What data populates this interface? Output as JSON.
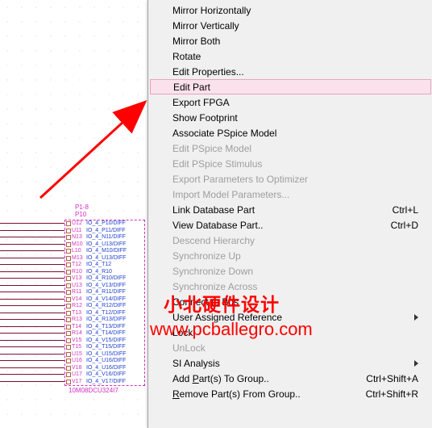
{
  "part": {
    "header_top": "P10",
    "header_group": "P1-8",
    "footer": "10M08DCU324I7",
    "pins": [
      {
        "num": "U12",
        "name": "IO_4_P10/DIFF"
      },
      {
        "num": "U11",
        "name": "IO_4_P11/DIFF"
      },
      {
        "num": "N13",
        "name": "IO_4_N11/DIFF"
      },
      {
        "num": "M10",
        "name": "IO_4_U13/DIFF"
      },
      {
        "num": "L10",
        "name": "IO_4_M10/DIFF"
      },
      {
        "num": "M13",
        "name": "IO_4_U13/DIFF"
      },
      {
        "num": "T12",
        "name": "IO_4_T12"
      },
      {
        "num": "R10",
        "name": "IO_4_R10"
      },
      {
        "num": "V13",
        "name": "IO_4_R10/DIFF"
      },
      {
        "num": "U13",
        "name": "IO_4_V13/DIFF"
      },
      {
        "num": "R11",
        "name": "IO_4_R11/DIFF"
      },
      {
        "num": "V14",
        "name": "IO_4_V14/DIFF"
      },
      {
        "num": "R12",
        "name": "IO_4_R12/DIFF"
      },
      {
        "num": "T13",
        "name": "IO_4_T12/DIFF"
      },
      {
        "num": "R13",
        "name": "IO_4_R13/DIFF"
      },
      {
        "num": "T14",
        "name": "IO_4_T13/DIFF"
      },
      {
        "num": "R14",
        "name": "IO_4_T14/DIFF"
      },
      {
        "num": "V15",
        "name": "IO_4_V15/DIFF"
      },
      {
        "num": "T15",
        "name": "IO_4_T15/DIFF"
      },
      {
        "num": "U15",
        "name": "IO_4_U15/DIFF"
      },
      {
        "num": "U16",
        "name": "IO_4_U16/DIFF"
      },
      {
        "num": "V18",
        "name": "IO_4_U16/DIFF"
      },
      {
        "num": "U17",
        "name": "IO_4_V16/DIFF"
      },
      {
        "num": "V17",
        "name": "IO_4_V17/DIFF"
      }
    ]
  },
  "menu": [
    {
      "label": "Mirror Horizontally",
      "enabled": true
    },
    {
      "label": "Mirror Vertically",
      "enabled": true
    },
    {
      "label": "Mirror Both",
      "enabled": true
    },
    {
      "label": "Rotate",
      "enabled": true
    },
    {
      "label": "Edit Properties...",
      "enabled": true
    },
    {
      "label": "Edit Part",
      "enabled": true,
      "highlight": true
    },
    {
      "label": "Export FPGA",
      "enabled": true
    },
    {
      "label": "Show Footprint",
      "enabled": true
    },
    {
      "label": "Associate PSpice Model",
      "enabled": true
    },
    {
      "label": "Edit PSpice Model",
      "enabled": false
    },
    {
      "label": "Edit PSpice Stimulus",
      "enabled": false
    },
    {
      "label": "Export Parameters to Optimizer",
      "enabled": false
    },
    {
      "label": "Import Model Parameters...",
      "enabled": false
    },
    {
      "label": "Link Database Part",
      "enabled": true,
      "accel": "Ctrl+L"
    },
    {
      "label": "View Database Part..",
      "enabled": true,
      "accel": "Ctrl+D"
    },
    {
      "label": "Descend Hierarchy",
      "enabled": false
    },
    {
      "label": "Synchronize Up",
      "enabled": false
    },
    {
      "label": "Synchronize Down",
      "enabled": false
    },
    {
      "label": "Synchronize Across",
      "enabled": false
    },
    {
      "label": "Connect to Bus",
      "enabled": true
    },
    {
      "label": "User Assigned Reference",
      "enabled": true,
      "submenu": true
    },
    {
      "label": "Lock",
      "enabled": true
    },
    {
      "label": "UnLock",
      "enabled": false
    },
    {
      "label": "SI Analysis",
      "enabled": true,
      "submenu": true
    },
    {
      "label": "Add Part(s) To Group..",
      "enabled": true,
      "accel": "Ctrl+Shift+A",
      "u": 4
    },
    {
      "label": "Remove Part(s) From Group..",
      "enabled": true,
      "accel": "Ctrl+Shift+R",
      "u": 0
    }
  ],
  "watermark": {
    "line1": "小北硬件设计",
    "line2": "www.pcballegro.com"
  }
}
